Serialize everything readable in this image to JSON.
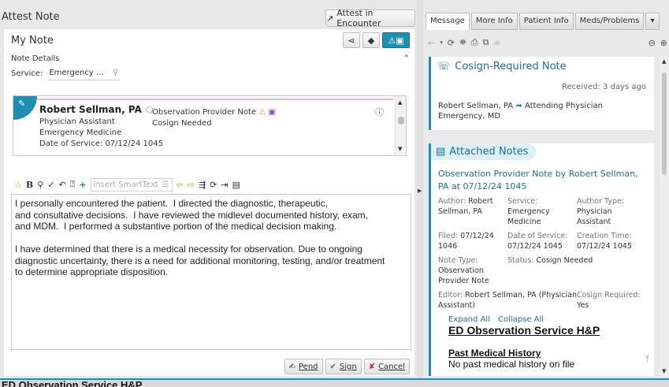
{
  "app_title": "Attest Note",
  "attest_button": "Attest in Encounter",
  "note": {
    "title": "My Note",
    "details_label": "Note Details",
    "service_label": "Service:",
    "service_value": "Emergency ..."
  },
  "card": {
    "author": "Robert Sellman, PA",
    "role": "Physician Assistant",
    "department": "Emergency Medicine",
    "date_of_service": "Date of Service: 07/12/24 1045",
    "note_type": "Observation Provider Note",
    "status": "Cosign Needed"
  },
  "editor": {
    "smarttext_placeholder": "Insert SmartText",
    "paragraph1": "I personally encountered the patient.  I directed the diagnostic, therapeutic,\nand consultative decisions.  I have reviewed the midlevel documented history, exam,\nand MDM.  I performed a substantive portion of the medical decision making.",
    "paragraph2": "I have determined that there is a medical necessity for observation. Due to ongoing\ndiagnostic uncertainty, there is a need for additional monitoring, testing, and/or treatment\nto determine appropriate disposition."
  },
  "footer": {
    "pend": "Pend",
    "sign": "Sign",
    "cancel": "Cancel"
  },
  "tabs": [
    "Message",
    "More Info",
    "Patient Info",
    "Meds/Problems"
  ],
  "cosign": {
    "title": "Cosign-Required Note",
    "received": "Received: 3 days ago",
    "from": "Robert Sellman, PA",
    "to": "Attending Physician Emergency, MD"
  },
  "attached": {
    "title": "Attached Notes",
    "note_title": "Observation Provider Note by Robert Sellman, PA at 07/12/24 1045",
    "meta": [
      {
        "k": "Author:",
        "v": "Robert Sellman, PA"
      },
      {
        "k": "Service:",
        "v": "Emergency Medicine"
      },
      {
        "k": "Author Type:",
        "v": "Physician Assistant"
      },
      {
        "k": "Filed:",
        "v": "07/12/24 1046"
      },
      {
        "k": "Date of Service:",
        "v": "07/12/24 1045"
      },
      {
        "k": "Creation Time:",
        "v": "07/12/24 1045"
      },
      {
        "k": "Note Type:",
        "v": "Observation Provider Note"
      },
      {
        "k": "Status:",
        "v": "Cosign Needed"
      },
      {
        "k": "",
        "v": ""
      },
      {
        "k": "Editor:",
        "v": "Robert Sellman, PA (Physician Assistant)"
      },
      {
        "k": "",
        "v": ""
      },
      {
        "k": "Cosign Required:",
        "v": "Yes"
      }
    ],
    "expand_all": "Expand All",
    "collapse_all": "Collapse All",
    "heading": "ED Observation Service H&P",
    "section": "Past Medical History",
    "section_text": "No past medical history on file"
  },
  "bottom_text": "ED Observation Service H&P",
  "colors": {
    "accent": "#1d8fb0",
    "warning": "#e8a317"
  }
}
